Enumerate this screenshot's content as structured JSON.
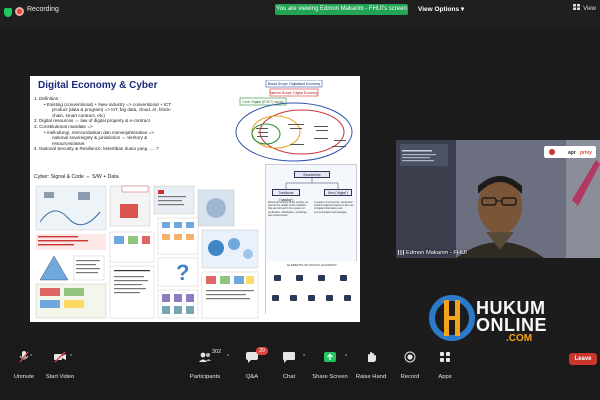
{
  "topbar": {
    "recording_label": "Recording",
    "viewing_banner": "You are viewing Edmon Makarim - FHUI's screen",
    "view_options_label": "View Options",
    "view_button_label": "View"
  },
  "slide": {
    "title": "Digital Economy & Cyber",
    "definition_heading": "1.   Definition :",
    "definition_lines": [
      "Existing (conventional) + New industry => conventional + ICT",
      "product (data & program) => IoT, big data, cloud, AI, block-",
      "chain, smart contract, etc)"
    ],
    "point2": "2.   Digital resources ⇔ law of digital property & e-contract",
    "point3": "3.   Constitutional mandate =>",
    "point3_lines": [
      "melindungi, mencerdaskan dan mensejahterakan =>",
      "national sovereignty & jurisdiction ⇔ territory &",
      "resources/asset"
    ],
    "point4": "4.   National Security & Resilience: ketertiban dunia yang ..... ?",
    "cyber_line": "Cyber: Signal & Code ⇔ S/W + Data",
    "venn_labels": [
      "Broad Scope: Digitalised Economy",
      "Narrow Scope: Digital Economy",
      "Core: Digital (IT/ICT) sector"
    ],
    "econ_top": "Economics",
    "econ_left": "Traditional (\"catalog\")",
    "econ_right": "New (\"digital\")",
    "econ_left_para": "Economic activity of the society, as well as the totality of the relations that are formed in the system of production, distribution, exchange and consumption",
    "econ_right_para": "A system of economic, social and cultural relations based on the use of digital information and communication technologies",
    "econ_icons_title": "ELEMENTS OF DIGITAL ECONOMY"
  },
  "video": {
    "participant_name": "Edmon Makarim - FHUI"
  },
  "watermark": {
    "line1": "HUKUM",
    "line2": "ONLINE",
    "line3": ".COM"
  },
  "toolbar": {
    "unmute": "Unmute",
    "start_video": "Start Video",
    "participants": "Participants",
    "participants_count": "302",
    "qa": "Q&A",
    "qa_badge": "20",
    "chat": "Chat",
    "share_screen": "Share Screen",
    "raise_hand": "Raise Hand",
    "record": "Record",
    "apps": "Apps",
    "leave": "Leave"
  },
  "colors": {
    "banner_green": "#23a455",
    "leave_red": "#c9362d",
    "share_green": "#23c55e",
    "watermark_orange": "#f4a41c"
  }
}
